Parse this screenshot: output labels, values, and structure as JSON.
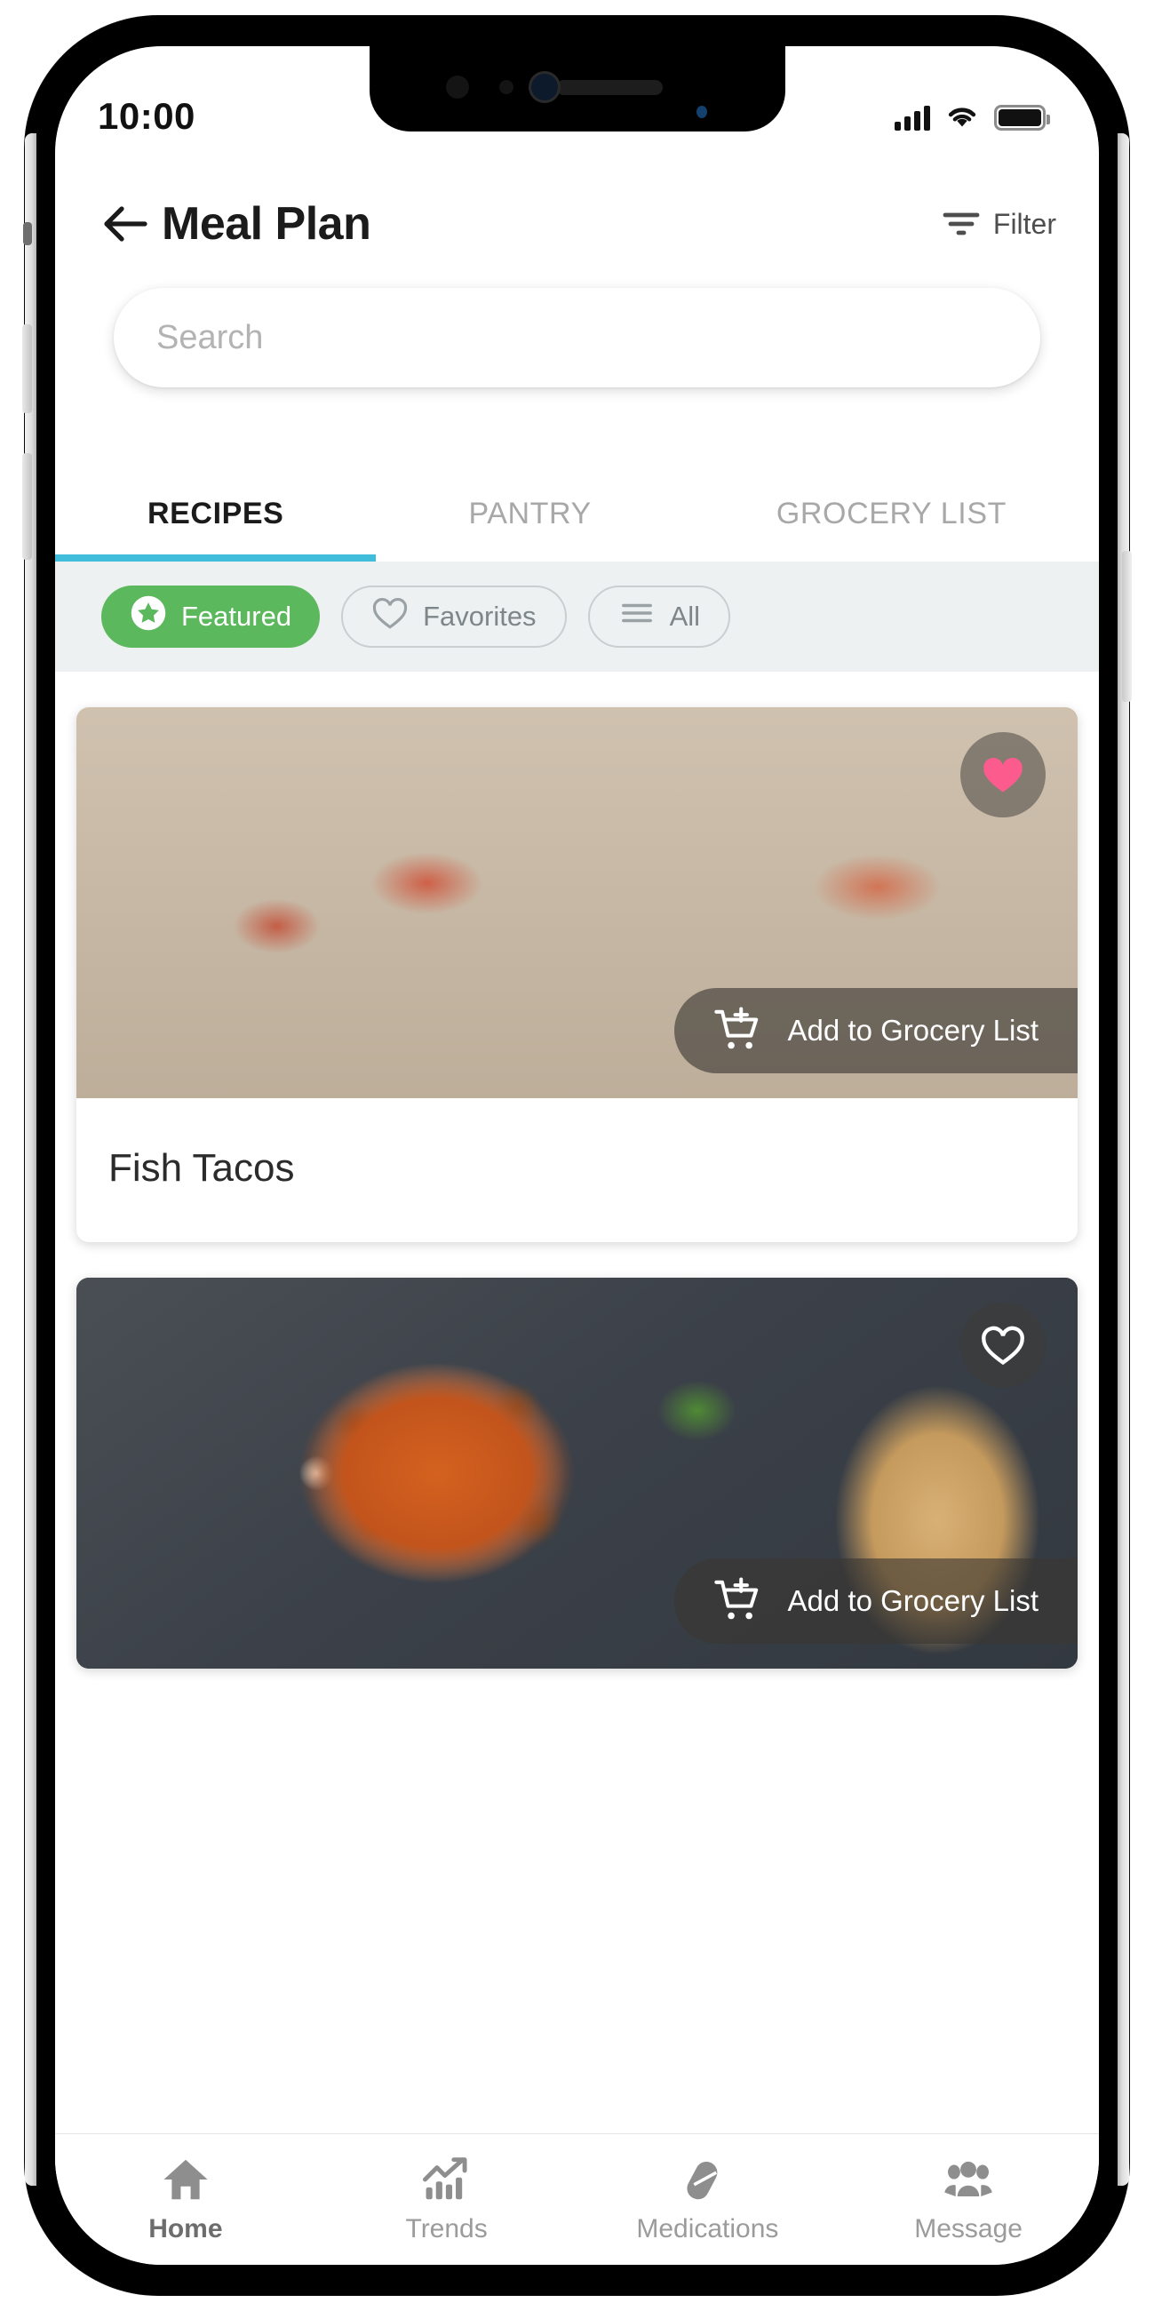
{
  "status_bar": {
    "time": "10:00",
    "signal_icon": "cellular-signal-icon",
    "wifi_icon": "wifi-icon",
    "battery_icon": "battery-full-icon"
  },
  "header": {
    "back_icon": "arrow-left-icon",
    "title": "Meal Plan",
    "filter_icon": "filter-icon",
    "filter_label": "Filter"
  },
  "search": {
    "placeholder": "Search",
    "value": ""
  },
  "tabs": [
    {
      "label": "RECIPES",
      "active": true
    },
    {
      "label": "PANTRY",
      "active": false
    },
    {
      "label": "GROCERY LIST",
      "active": false
    }
  ],
  "chips": [
    {
      "label": "Featured",
      "icon": "star-circle-icon",
      "active": true
    },
    {
      "label": "Favorites",
      "icon": "heart-outline-icon",
      "active": false
    },
    {
      "label": "All",
      "icon": "list-lines-icon",
      "active": false
    }
  ],
  "recipes": [
    {
      "title": "Fish Tacos",
      "favorited": true,
      "favorite_icon": "heart-filled-icon",
      "add_icon": "cart-plus-icon",
      "add_label": "Add to Grocery List",
      "image_alt": "Two soft fish tacos with shredded lettuce and pico de gallo on a white plate"
    },
    {
      "title": "",
      "favorited": false,
      "favorite_icon": "heart-outline-icon",
      "add_icon": "cart-plus-icon",
      "add_label": "Add to Grocery List",
      "image_alt": "Baked meatballs in tomato sauce with melted cheese and grilled bread"
    }
  ],
  "bottom_nav": [
    {
      "label": "Home",
      "icon": "home-icon",
      "active": true
    },
    {
      "label": "Trends",
      "icon": "trending-up-icon",
      "active": false
    },
    {
      "label": "Medications",
      "icon": "pill-icon",
      "active": false
    },
    {
      "label": "Message",
      "icon": "people-icon",
      "active": false
    }
  ],
  "colors": {
    "accent_green": "#5cb85c",
    "tab_underline": "#3fbdda",
    "heart_pink": "#fc5c8d",
    "chip_bar_bg": "#edf1f2",
    "text_primary": "#1b1b1b",
    "text_muted": "#a8a8a8"
  }
}
